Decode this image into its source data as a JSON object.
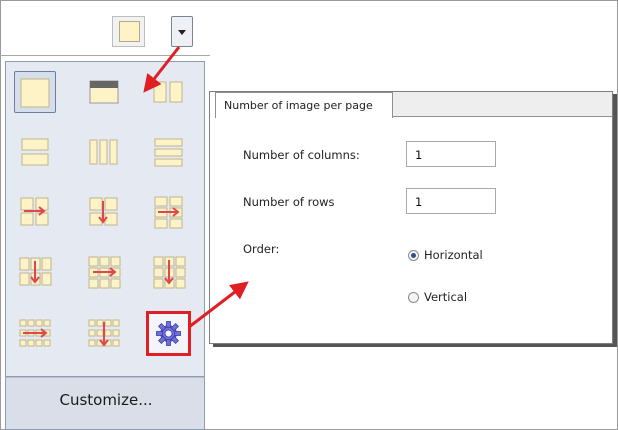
{
  "dropdown": {
    "selected_layout_icon": "single-page-layout-icon",
    "layouts": [
      {
        "name": "layout-single-icon",
        "state": "selected"
      },
      {
        "name": "layout-single-header-icon",
        "state": "normal"
      },
      {
        "name": "layout-two-columns-icon",
        "state": "normal"
      },
      {
        "name": "layout-two-rows-icon",
        "state": "normal"
      },
      {
        "name": "layout-three-columns-icon",
        "state": "normal"
      },
      {
        "name": "layout-three-rows-icon",
        "state": "normal"
      },
      {
        "name": "layout-2x2-horizontal-icon",
        "state": "normal"
      },
      {
        "name": "layout-2x2-vertical-icon",
        "state": "normal"
      },
      {
        "name": "layout-2x3-horizontal-icon",
        "state": "normal"
      },
      {
        "name": "layout-3x2-vertical-icon",
        "state": "normal"
      },
      {
        "name": "layout-3x3-horizontal-icon",
        "state": "normal"
      },
      {
        "name": "layout-3x3-vertical-icon",
        "state": "normal"
      },
      {
        "name": "layout-4x3-horizontal-icon",
        "state": "normal"
      },
      {
        "name": "layout-4x3-vertical-icon",
        "state": "normal"
      },
      {
        "name": "layout-custom-gear-icon",
        "state": "highlighted"
      }
    ],
    "customize_label": "Customize..."
  },
  "dialog": {
    "tab_label": "Number of image per page",
    "columns_label": "Number of columns:",
    "columns_value": "1",
    "rows_label": "Number of rows",
    "rows_value": "1",
    "order_label": "Order:",
    "order_options": [
      "Horizontal",
      "Vertical"
    ],
    "order_selected": "Horizontal"
  },
  "colors": {
    "annotation_red": "#e01f25",
    "panel_bg": "#e5e9f2",
    "page_fill": "#fdf3c6",
    "arrow_icon_red": "#e0474c"
  }
}
